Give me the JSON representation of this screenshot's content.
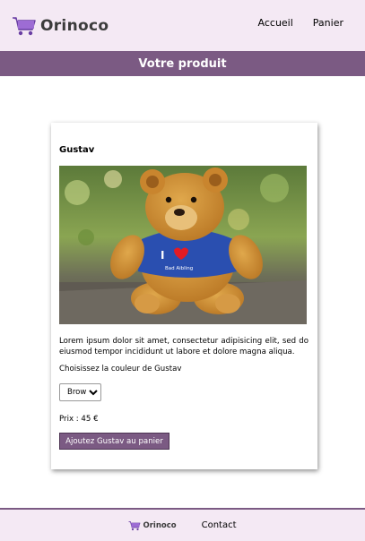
{
  "header": {
    "brand_name": "Orinoco",
    "nav": [
      {
        "label": "Accueil"
      },
      {
        "label": "Panier"
      }
    ]
  },
  "banner": {
    "title": "Votre produit"
  },
  "product": {
    "name": "Gustav",
    "image_icon": "teddy-bear-photo",
    "description": "Lorem ipsum dolor sit amet, consectetur adipisicing elit, sed do eiusmod tempor incididunt ut labore et dolore magna aliqua.",
    "color_label": "Choisissez la couleur de Gustav",
    "color_selected": "Brown",
    "price_text": "Prix : 45 €",
    "add_button_label": "Ajoutez Gustav au panier"
  },
  "footer": {
    "brand_name": "Orinoco",
    "contact_label": "Contact"
  },
  "colors": {
    "accent": "#7b5a83",
    "header_bg": "#f4e9f4"
  }
}
